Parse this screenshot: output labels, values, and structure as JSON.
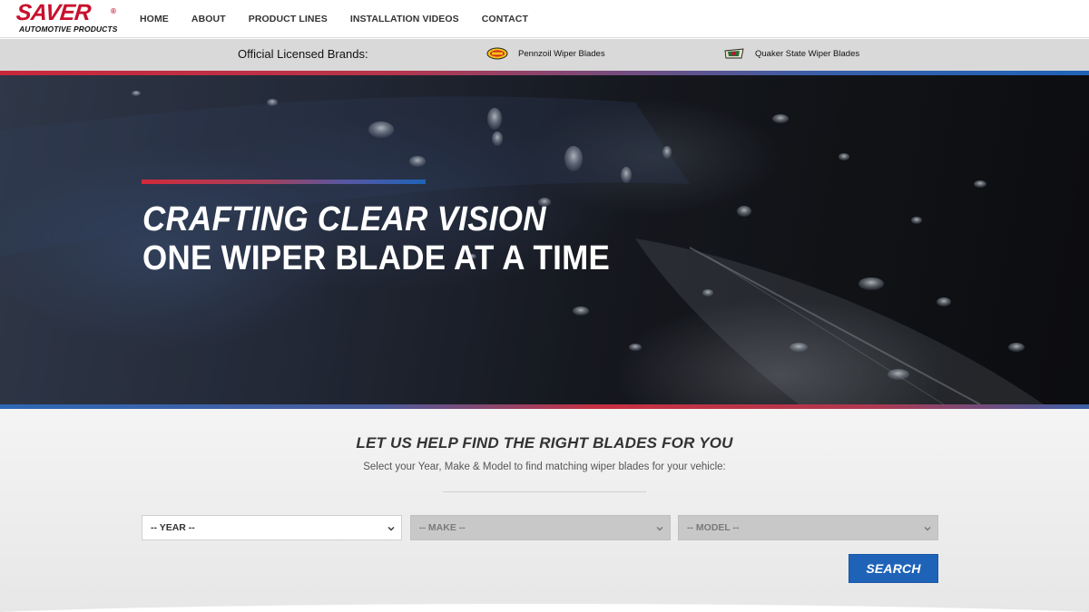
{
  "header": {
    "logo": {
      "brand": "SAVER",
      "registered": "®",
      "tagline": "AUTOMOTIVE PRODUCTS"
    },
    "nav": [
      "HOME",
      "ABOUT",
      "PRODUCT LINES",
      "INSTALLATION VIDEOS",
      "CONTACT"
    ]
  },
  "brands_bar": {
    "label": "Official Licensed Brands:",
    "items": [
      {
        "name": "Pennzoil Wiper Blades",
        "icon": "pennzoil-logo-icon"
      },
      {
        "name": "Quaker State Wiper Blades",
        "icon": "quaker-state-logo-icon"
      }
    ]
  },
  "hero": {
    "line1": "CRAFTING CLEAR VISION",
    "line2": "ONE WIPER BLADE AT A TIME"
  },
  "finder": {
    "title": "LET US HELP FIND THE RIGHT BLADES FOR YOU",
    "subtitle": "Select your Year, Make & Model to find matching wiper blades for your vehicle:",
    "year_select": "-- YEAR --",
    "make_select": "-- MAKE --",
    "model_select": "-- MODEL --",
    "search_button": "SEARCH"
  },
  "colors": {
    "brand_red": "#c8102e",
    "brand_blue": "#1f63b8",
    "nav_text": "#333333",
    "brands_bar_bg": "#d9d9d9",
    "finder_bg": "#eeeeee"
  }
}
